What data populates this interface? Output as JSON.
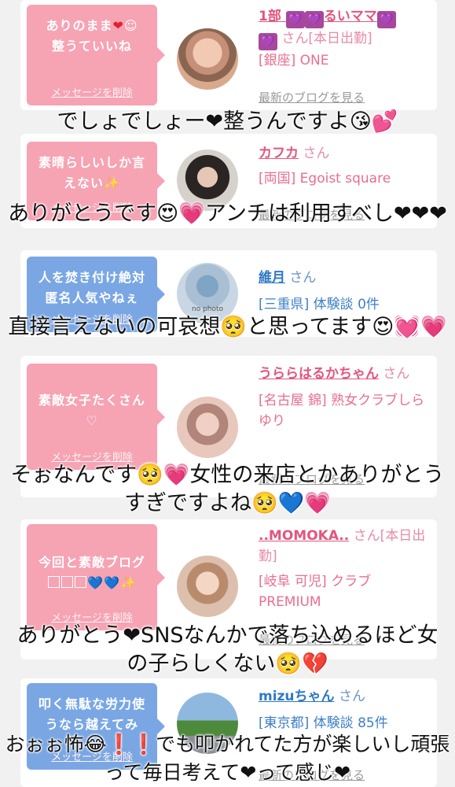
{
  "cards": [
    {
      "bubble_color": "pink",
      "message": "ありのまま❤☺整うていいね",
      "delete_label": "メッセージを削除",
      "name_prefix": "1部",
      "name_suffix": "るいママ",
      "san": "さん[本日出勤]",
      "location": "[銀座] ONE",
      "blog_label": "最新のブログを見る"
    },
    {
      "bubble_color": "pink",
      "message": "素晴らしいしか言えない✨",
      "delete_label": "メッセージを削除",
      "name": "カフカ",
      "san": "さん",
      "location": "[両国] Egoist square",
      "blog_label": "最新のブログを見る"
    },
    {
      "bubble_color": "blue",
      "message": "人を焚き付け絶対匿名人気やねぇ",
      "delete_label": "メッセージを削除",
      "name": "維月",
      "san": "さん",
      "location": "[三重県] 体験談 0件",
      "avatar_text": "no photo"
    },
    {
      "bubble_color": "pink",
      "message": "素敵女子たくさん♡",
      "delete_label": "メッセージを削除",
      "name": "うららはるかちゃん",
      "san": "さん",
      "location": "[名古屋 錦] 熟女クラブしらゆり",
      "blog_label": "最新のブログを見る"
    },
    {
      "bubble_color": "pink",
      "message": "今回と素敵ブログ",
      "delete_label": "メッセージを削除",
      "name": "..MOMOKA..",
      "san": "さん[本日出勤]",
      "location": "[岐阜 可児] クラブPREMIUM",
      "blog_label": "最新のブログを見る"
    },
    {
      "bubble_color": "blue",
      "message": "叩く無駄な労力使うなら越えてみ",
      "delete_label": "メッセージを削除",
      "name": "mizuちゃん",
      "san": "さん",
      "location": "[東京都] 体験談 85件",
      "blog_label": "最新のブログを見る"
    }
  ],
  "overlays": [
    "でしょでしょー❤整うんですよ😘💕",
    "ありがとうです😍💗アンチは利用すべし❤❤❤",
    "直接言えないの可哀想🥺と思ってます😍💓💗",
    "そぉなんです🥺💗女性の来店とかありがとうすぎですよね🥺💙💗",
    "ありがとう❤SNSなんかで落ち込めるほど女の子らしくない🥺💔",
    "おぉぉ怖😂❗❗でも叩かれてた方が楽しいし頑張って毎日考えて❤って感じ❤"
  ],
  "colors": {
    "pink_bubble": "#f6a3b3",
    "blue_bubble": "#7aa7e4",
    "heart": "#e0212e"
  }
}
